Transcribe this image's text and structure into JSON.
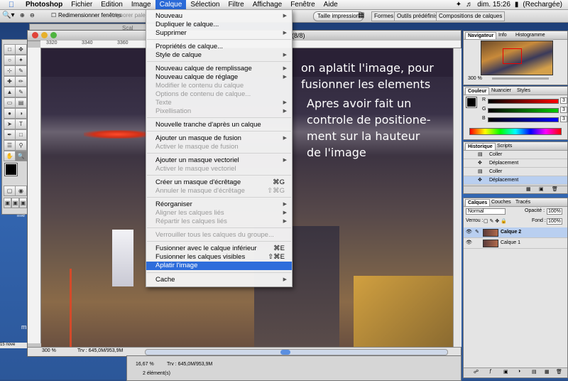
{
  "menubar": {
    "app": "Photoshop",
    "items": [
      "Fichier",
      "Edition",
      "Image",
      "Calque",
      "Sélection",
      "Filtre",
      "Affichage",
      "Fenêtre",
      "Aide"
    ],
    "active": "Calque",
    "clock": "dim. 15:26",
    "recharge": "(Rechargée)"
  },
  "optionsbar": {
    "checkbox_label": "Redimensionner fenêtres",
    "ignore_label": "Ignorer pale",
    "print_size_button": "Taille impression",
    "tabs": [
      "Formes",
      "Outils prédéfinis",
      "Compositions de calques"
    ]
  },
  "document": {
    "title_suffix": "(8/8)",
    "back_title": "Scal",
    "ruler_ticks": [
      "3320",
      "3340",
      "3360",
      "3380"
    ],
    "zoom": "300 %",
    "doc_size": "Trv : 645,0M/953,9M",
    "colors": {
      "accent": "#2e6ddb"
    }
  },
  "notes": {
    "line1": "on aplatit l'image, pour",
    "line2": "fusionner les elements",
    "line3": "Apres avoir fait un",
    "line4": "controle de positione-",
    "line5": "ment sur la hauteur",
    "line6": "de l'image"
  },
  "calque_menu": {
    "items": [
      {
        "label": "Nouveau",
        "shortcut": "",
        "submenu": true,
        "disabled": false
      },
      {
        "label": "Dupliquer le calque...",
        "shortcut": "",
        "submenu": false,
        "disabled": false
      },
      {
        "label": "Supprimer",
        "shortcut": "",
        "submenu": true,
        "disabled": false
      },
      {
        "label": "Propriétés de calque...",
        "shortcut": "",
        "submenu": false,
        "disabled": false
      },
      {
        "label": "Style de calque",
        "shortcut": "",
        "submenu": true,
        "disabled": false
      },
      {
        "label": "Nouveau calque de remplissage",
        "shortcut": "",
        "submenu": true,
        "disabled": false
      },
      {
        "label": "Nouveau calque de réglage",
        "shortcut": "",
        "submenu": true,
        "disabled": false
      },
      {
        "label": "Modifier le contenu du calque",
        "shortcut": "",
        "submenu": false,
        "disabled": true
      },
      {
        "label": "Options de contenu de calque...",
        "shortcut": "",
        "submenu": false,
        "disabled": true
      },
      {
        "label": "Texte",
        "shortcut": "",
        "submenu": true,
        "disabled": true
      },
      {
        "label": "Pixellisation",
        "shortcut": "",
        "submenu": true,
        "disabled": true
      },
      {
        "label": "Nouvelle tranche d'après un calque",
        "shortcut": "",
        "submenu": false,
        "disabled": false
      },
      {
        "label": "Ajouter un masque de fusion",
        "shortcut": "",
        "submenu": true,
        "disabled": false
      },
      {
        "label": "Activer le masque de fusion",
        "shortcut": "",
        "submenu": false,
        "disabled": true
      },
      {
        "label": "Ajouter un masque vectoriel",
        "shortcut": "",
        "submenu": true,
        "disabled": false
      },
      {
        "label": "Activer le masque vectoriel",
        "shortcut": "",
        "submenu": false,
        "disabled": true
      },
      {
        "label": "Créer un masque d'écrêtage",
        "shortcut": "⌘G",
        "submenu": false,
        "disabled": false
      },
      {
        "label": "Annuler le masque d'écrêtage",
        "shortcut": "⇧⌘G",
        "submenu": false,
        "disabled": true
      },
      {
        "label": "Réorganiser",
        "shortcut": "",
        "submenu": true,
        "disabled": false
      },
      {
        "label": "Aligner les calques liés",
        "shortcut": "",
        "submenu": true,
        "disabled": true
      },
      {
        "label": "Répartir les calques liés",
        "shortcut": "",
        "submenu": true,
        "disabled": true
      },
      {
        "label": "Verrouiller tous les calques du groupe...",
        "shortcut": "",
        "submenu": false,
        "disabled": true
      },
      {
        "label": "Fusionner avec le calque inférieur",
        "shortcut": "⌘E",
        "submenu": false,
        "disabled": false
      },
      {
        "label": "Fusionner les calques visibles",
        "shortcut": "⇧⌘E",
        "submenu": false,
        "disabled": false
      },
      {
        "label": "Aplatir l'image",
        "shortcut": "",
        "submenu": false,
        "disabled": false,
        "highlighted": true
      },
      {
        "label": "Cache",
        "shortcut": "",
        "submenu": true,
        "disabled": false
      }
    ]
  },
  "navigator": {
    "tabs": [
      "Navigateur",
      "Info",
      "Histogramme"
    ],
    "zoom": "300 %"
  },
  "color_panel": {
    "tabs": [
      "Couleur",
      "Nuancier",
      "Styles"
    ],
    "r_label": "R",
    "g_label": "G",
    "b_label": "B",
    "r": "3",
    "g": "3",
    "b": "3"
  },
  "history": {
    "tabs": [
      "Historique",
      "Scripts"
    ],
    "items": [
      "Coller",
      "Déplacement",
      "Coller",
      "Déplacement"
    ]
  },
  "layers": {
    "tabs": [
      "Calques",
      "Couches",
      "Tracés"
    ],
    "blend": "Normal",
    "opacity_label": "Opacité :",
    "opacity": "100%",
    "lock_label": "Verrou :",
    "fill_label": "Fond :",
    "fill": "100%",
    "items": [
      "Calque 2",
      "Calque 1"
    ]
  },
  "statusbar": {
    "zoom": "16,67 %",
    "doc": "Trv : 645,0M/953,9M",
    "elements": "2 élément(s)"
  },
  "desktop": {
    "left_tag": "infe",
    "taskbar": "15 nove",
    "letter_m": "m"
  }
}
